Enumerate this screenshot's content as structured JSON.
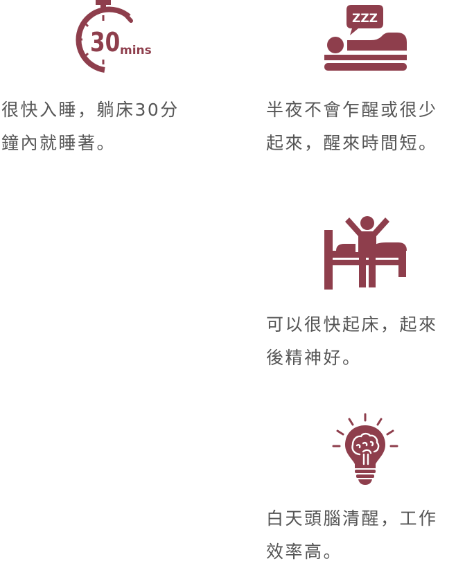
{
  "accent_color": "#8e3e4c",
  "items": [
    {
      "icon": "stopwatch-30-mins-icon",
      "icon_number": "30",
      "icon_unit": "mins",
      "lines": [
        "很快入睡，躺床30分",
        "鐘內就睡著。"
      ]
    },
    {
      "icon": "sleeping-in-bed-zzz-icon",
      "icon_text": "ZZZ",
      "lines": [
        "半夜不會乍醒或很少",
        "起來，醒來時間短。"
      ]
    },
    {
      "icon": "person-waking-up-bed-icon",
      "lines": [
        "可以很快起床，起來",
        "後精神好。"
      ]
    },
    {
      "icon": "brain-lightbulb-icon",
      "lines": [
        "白天頭腦清醒，工作",
        "效率高。"
      ]
    }
  ]
}
